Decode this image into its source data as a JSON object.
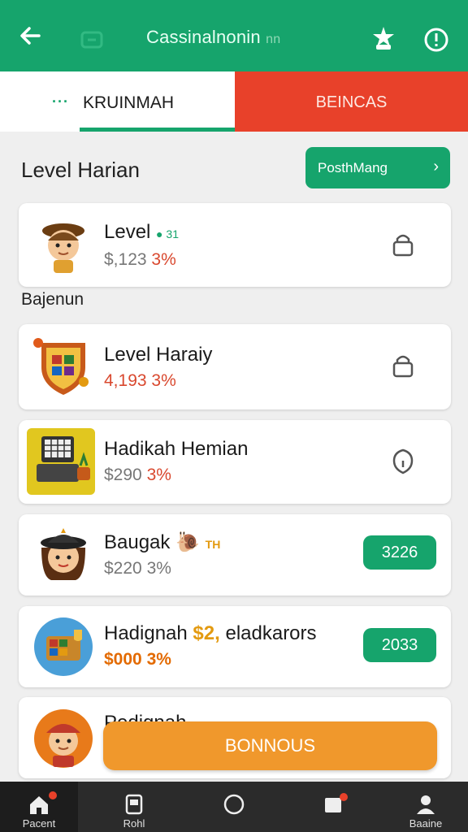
{
  "header": {
    "title": "Cassinalnonin",
    "title_suffix": "nn"
  },
  "tabs": [
    {
      "label": "KRUINMAH",
      "active": true
    },
    {
      "label": "BEINCAS",
      "active": false
    }
  ],
  "section": {
    "title": "Level Harian",
    "action_label": "PosthMang",
    "sublabel": "Bajenun"
  },
  "cards": [
    {
      "name": "Level",
      "tag": "31",
      "amount": "$,123",
      "pct": "3%",
      "trail": "lock"
    },
    {
      "name": "Level Haraiy",
      "amount": "4,193",
      "pct": "3%",
      "trail": "lock"
    },
    {
      "name": "Hadikah Hemian",
      "amount": "$290",
      "pct": "3%",
      "trail": "lock"
    },
    {
      "name": "Baugak",
      "tag": "TH",
      "amount": "$220",
      "pct": "3%",
      "trail": "badge",
      "badge": "3226"
    },
    {
      "name": "Hadignah",
      "name_gold": "$2,",
      "name_tail": "eladkarors",
      "amount": "$000",
      "pct": "3%",
      "trail": "badge",
      "badge": "2033"
    },
    {
      "name": "Pedignah"
    }
  ],
  "bonus_label": "BONNOUS",
  "nav": [
    {
      "label": "Pacent"
    },
    {
      "label": "Rohl"
    },
    {
      "label": ""
    },
    {
      "label": ""
    },
    {
      "label": "Baaine"
    }
  ],
  "colors": {
    "primary": "#16a46c",
    "accent_red": "#e8412a",
    "bonus_orange": "#f0982c"
  }
}
